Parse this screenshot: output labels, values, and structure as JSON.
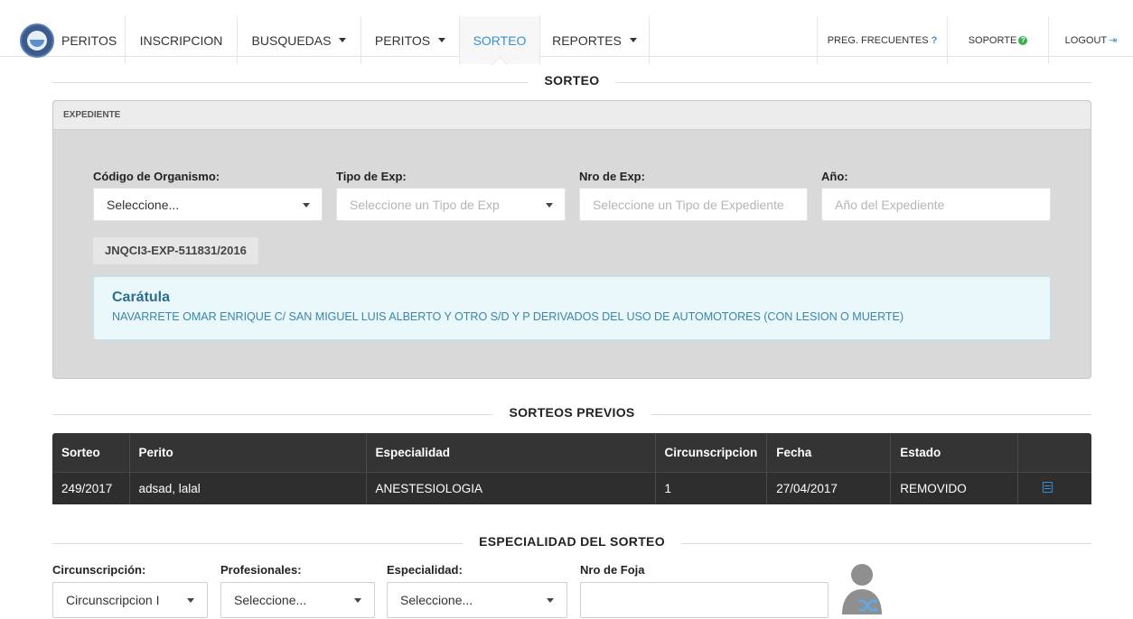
{
  "nav": {
    "brand": "PERITOS",
    "items": [
      {
        "label": "INSCRIPCION",
        "dropdown": false
      },
      {
        "label": "BUSQUEDAS",
        "dropdown": true
      },
      {
        "label": "PERITOS",
        "dropdown": true
      },
      {
        "label": "SORTEO",
        "dropdown": false,
        "active": true
      },
      {
        "label": "REPORTES",
        "dropdown": true
      }
    ],
    "faq": "PREG. FRECUENTES",
    "faq_mark": "?",
    "support": "SOPORTE",
    "logout": "LOGOUT",
    "active_color": "#3a8fd3"
  },
  "page_title": "SORTEO",
  "expediente": {
    "header": "EXPEDIENTE",
    "codigo_label": "Código de Organismo:",
    "codigo_value": "Seleccione...",
    "tipo_label": "Tipo de Exp:",
    "tipo_placeholder": "Seleccione un Tipo de Exp",
    "nro_label": "Nro de Exp:",
    "nro_placeholder": "Seleccione un Tipo de Expediente",
    "anio_label": "Año:",
    "anio_placeholder": "Año del Expediente",
    "tag": "JNQCI3-EXP-511831/2016",
    "caratula_title": "Carátula",
    "caratula_text": "NAVARRETE OMAR ENRIQUE C/ SAN MIGUEL LUIS ALBERTO Y OTRO S/D Y P DERIVADOS DEL USO DE AUTOMOTORES (CON LESION O MUERTE)"
  },
  "previos": {
    "title": "SORTEOS PREVIOS",
    "columns": [
      "Sorteo",
      "Perito",
      "Especialidad",
      "Circunscripcion",
      "Fecha",
      "Estado",
      ""
    ],
    "rows": [
      {
        "sorteo": "249/2017",
        "perito": "adsad, lalal",
        "especialidad": "ANESTESIOLOGIA",
        "circunscripcion": "1",
        "fecha": "27/04/2017",
        "estado": "REMOVIDO"
      }
    ]
  },
  "especialidad": {
    "title": "ESPECIALIDAD DEL SORTEO",
    "circ_label": "Circunscripción:",
    "circ_value": "Circunscripcion I",
    "prof_label": "Profesionales:",
    "prof_value": "Seleccione...",
    "esp_label": "Especialidad:",
    "esp_value": "Seleccione...",
    "foja_label": "Nro de Foja",
    "foja_value": "",
    "sortear_icon": "user-shuffle-icon"
  }
}
